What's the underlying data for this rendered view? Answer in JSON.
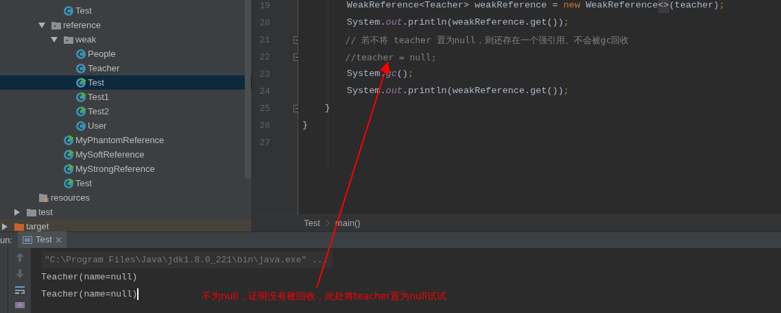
{
  "project_tree": [
    {
      "children": [
        {
          "children": [
            {
              "children": [
                {
                  "children": [
                    {
                      "label": "Test",
                      "kind": "class",
                      "selected": false
                    }
                  ]
                },
                {
                  "label": "reference",
                  "kind": "package",
                  "expanded": true,
                  "selected": false,
                  "children": [
                    {
                      "label": "weak",
                      "kind": "package",
                      "expanded": true,
                      "selected": false,
                      "children": [
                        {
                          "label": "People",
                          "kind": "class",
                          "selected": false
                        },
                        {
                          "label": "Teacher",
                          "kind": "class",
                          "selected": false
                        },
                        {
                          "label": "Test",
                          "kind": "runnable_class",
                          "selected": true
                        },
                        {
                          "label": "Test1",
                          "kind": "runnable_class",
                          "selected": false
                        },
                        {
                          "label": "Test2",
                          "kind": "runnable_class",
                          "selected": false
                        },
                        {
                          "label": "User",
                          "kind": "class",
                          "selected": false
                        }
                      ]
                    },
                    {
                      "label": "MyPhantomReference",
                      "kind": "runnable_class",
                      "selected": false
                    },
                    {
                      "label": "MySoftReference",
                      "kind": "runnable_class",
                      "selected": false
                    },
                    {
                      "label": "MyStrongReference",
                      "kind": "runnable_class",
                      "selected": false
                    },
                    {
                      "label": "Test",
                      "kind": "runnable_class",
                      "selected": false
                    }
                  ]
                }
              ]
            },
            {
              "label": "resources",
              "kind": "resources_folder",
              "selected": false
            }
          ]
        },
        {
          "label": "test",
          "kind": "folder",
          "expanded": false,
          "selected": false
        }
      ]
    },
    {
      "label": "target",
      "kind": "excluded_folder",
      "expanded": false,
      "selected": false
    }
  ],
  "editor": {
    "lines": [
      {
        "number": "19",
        "fold": false,
        "tokens": [
          {
            "kind": "plain",
            "text": "        WeakReference<Teacher> weakReference = "
          },
          {
            "kind": "keyword",
            "text": "new"
          },
          {
            "kind": "plain",
            "text": " WeakReference"
          },
          {
            "kind": "hint",
            "text": "<>"
          },
          {
            "kind": "plain",
            "text": "(teacher)"
          },
          {
            "kind": "keyword",
            "text": ";"
          }
        ]
      },
      {
        "number": "20",
        "fold": false,
        "tokens": [
          {
            "kind": "plain",
            "text": "        System."
          },
          {
            "kind": "static",
            "text": "out"
          },
          {
            "kind": "plain",
            "text": ".println(weakReference.get())"
          },
          {
            "kind": "keyword",
            "text": ";"
          }
        ]
      },
      {
        "number": "21",
        "fold": true,
        "tokens": [
          {
            "kind": "comment",
            "text": "        // 若不将 teacher 置为null，则还存在一个强引用。不会被gc回收"
          }
        ]
      },
      {
        "number": "22",
        "fold": true,
        "tokens": [
          {
            "kind": "comment",
            "text": "        //teacher = null;"
          }
        ]
      },
      {
        "number": "23",
        "fold": false,
        "tokens": [
          {
            "kind": "plain",
            "text": "        System."
          },
          {
            "kind": "static",
            "text": "gc"
          },
          {
            "kind": "plain",
            "text": "()"
          },
          {
            "kind": "keyword",
            "text": ";"
          }
        ]
      },
      {
        "number": "24",
        "fold": false,
        "tokens": [
          {
            "kind": "plain",
            "text": "        System."
          },
          {
            "kind": "static",
            "text": "out"
          },
          {
            "kind": "plain",
            "text": ".println(weakReference.get())"
          },
          {
            "kind": "keyword",
            "text": ";"
          }
        ]
      },
      {
        "number": "25",
        "fold": true,
        "tokens": [
          {
            "kind": "plain",
            "text": "    }"
          }
        ]
      },
      {
        "number": "26",
        "fold": false,
        "tokens": [
          {
            "kind": "plain",
            "text": "}"
          }
        ]
      },
      {
        "number": "27"
      }
    ],
    "breadcrumbs": [
      "Test",
      "main()"
    ]
  },
  "run_panel": {
    "label": "un:",
    "tabs": [
      {
        "label": "Test",
        "selected": true
      }
    ],
    "console": [
      {
        "kind": "command",
        "text": "\"C:\\Program Files\\Java\\jdk1.8.0_221\\bin\\java.exe\" ..."
      },
      {
        "kind": "output",
        "text": "Teacher(name=null)"
      },
      {
        "kind": "output",
        "text": "Teacher(name=null)"
      }
    ]
  },
  "annotation": {
    "text": "不为null，证明没有被回收，此处将teacher置为null试试"
  }
}
